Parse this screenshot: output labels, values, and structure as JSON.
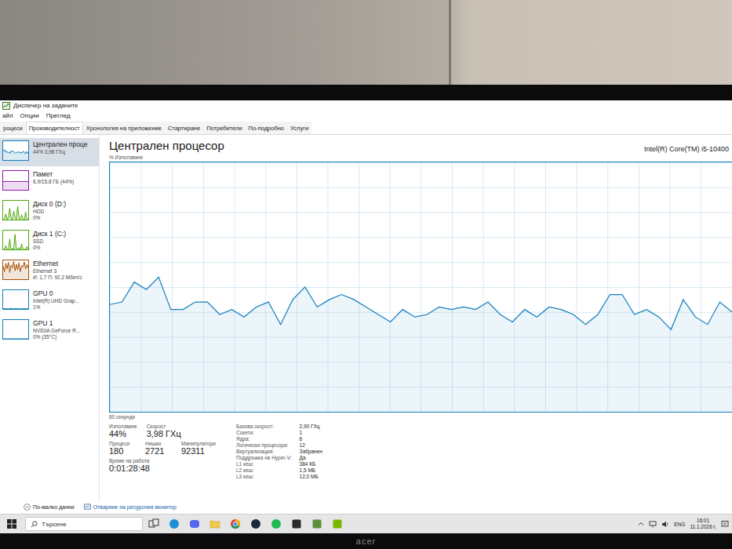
{
  "window": {
    "title": "Диспечер на задачите"
  },
  "menu": [
    "айл",
    "Опции",
    "Преглед"
  ],
  "tabs": [
    {
      "label": "роцеси",
      "selected": false
    },
    {
      "label": "Производителност",
      "selected": true
    },
    {
      "label": "Хронология на приложение",
      "selected": false
    },
    {
      "label": "Стартиране",
      "selected": false
    },
    {
      "label": "Потребители",
      "selected": false
    },
    {
      "label": "По-подробно",
      "selected": false
    },
    {
      "label": "Услуги",
      "selected": false
    }
  ],
  "sidebar": {
    "items": [
      {
        "name": "Централен проце",
        "lines": [
          "44% 3,98 ГХц"
        ],
        "selected": true,
        "color": "#117dbb",
        "values": [
          43,
          52,
          54,
          41,
          44,
          39,
          42,
          35,
          50,
          45,
          47,
          42,
          36,
          38,
          42,
          41,
          44,
          36,
          41,
          39,
          47,
          39,
          33,
          45,
          35,
          44
        ]
      },
      {
        "name": "Памет",
        "lines": [
          "6,9/15,8 ГБ (44%)"
        ],
        "selected": false,
        "color": "#8b12ae",
        "values": [
          44,
          44,
          44,
          44,
          44,
          44,
          44,
          44,
          44,
          44,
          44,
          44,
          44,
          44,
          44,
          44
        ]
      },
      {
        "name": "Диск 0 (D:)",
        "lines": [
          "HDD",
          "0%"
        ],
        "selected": false,
        "color": "#4da60c",
        "values": [
          0,
          5,
          30,
          0,
          10,
          60,
          5,
          0,
          45,
          15,
          0,
          70,
          10,
          0,
          25,
          5,
          0,
          40,
          0,
          0
        ]
      },
      {
        "name": "Диск 1 (C:)",
        "lines": [
          "SSD",
          "0%"
        ],
        "selected": false,
        "color": "#4da60c",
        "values": [
          0,
          0,
          20,
          0,
          0,
          55,
          0,
          5,
          0,
          80,
          0,
          0,
          10,
          0,
          30,
          0,
          0,
          0,
          15,
          0
        ]
      },
      {
        "name": "Ethernet",
        "lines": [
          "Ethernet 3",
          "И: 1,7 П: 92,2 Мбит/с"
        ],
        "selected": false,
        "color": "#a74f01",
        "values": [
          70,
          40,
          85,
          55,
          90,
          35,
          75,
          60,
          95,
          45,
          80,
          50,
          88,
          40,
          72,
          65,
          92,
          55,
          78,
          60
        ]
      },
      {
        "name": "GPU 0",
        "lines": [
          "Intel(R) UHD Grap...",
          "1%"
        ],
        "selected": false,
        "color": "#117dbb",
        "values": [
          1,
          2,
          1,
          1,
          3,
          1,
          1,
          2,
          1,
          1,
          1,
          2,
          1,
          1
        ]
      },
      {
        "name": "GPU 1",
        "lines": [
          "NVIDIA GeForce R...",
          "0% (35°C)"
        ],
        "selected": false,
        "color": "#117dbb",
        "values": [
          0,
          0,
          0,
          0,
          0,
          0,
          0,
          0,
          0,
          0,
          0,
          0
        ]
      }
    ]
  },
  "chart": {
    "title": "Централен процесор",
    "model": "Intel(R) Core(TM) i5-10400",
    "axis_label": "% Използване",
    "time_label": "60 секунди",
    "max": 100,
    "values": [
      43,
      44,
      52,
      49,
      54,
      41,
      41,
      44,
      44,
      39,
      41,
      38,
      42,
      44,
      35,
      45,
      50,
      42,
      45,
      47,
      45,
      42,
      39,
      36,
      41,
      38,
      39,
      42,
      41,
      42,
      41,
      44,
      39,
      36,
      41,
      38,
      42,
      41,
      39,
      35,
      39,
      47,
      47,
      39,
      41,
      38,
      33,
      45,
      38,
      35,
      44,
      40
    ]
  },
  "stats": [
    [
      {
        "label": "Използване",
        "value": "44%"
      },
      {
        "label": "Скорост",
        "value": "3,98 ГХц"
      }
    ],
    [
      {
        "label": "Процеси",
        "value": "180"
      },
      {
        "label": "Нишки",
        "value": "2721"
      },
      {
        "label": "Манипулатори",
        "value": "92311"
      }
    ],
    [
      {
        "label": "Време на работа",
        "value": "0:01:28:48"
      }
    ]
  ],
  "details": [
    {
      "label": "Базова скорост:",
      "value": "2,90 ГХц"
    },
    {
      "label": "Сокети:",
      "value": "1"
    },
    {
      "label": "Ядра:",
      "value": "6"
    },
    {
      "label": "Логически процесори:",
      "value": "12"
    },
    {
      "label": "Виртуализация:",
      "value": "Забранен"
    },
    {
      "label": "Поддръжка на Hyper-V:",
      "value": "Да"
    },
    {
      "label": "L1 кеш:",
      "value": "384 КБ"
    },
    {
      "label": "L2 кеш:",
      "value": "1,5 МБ"
    },
    {
      "label": "L3 кеш:",
      "value": "12,0 МБ"
    }
  ],
  "footer": {
    "less": "По-малко данни",
    "monitor": "Отваряне на ресурсния монитор"
  },
  "taskbar": {
    "search": "Търсене",
    "language": "ENG",
    "time": "16:01",
    "date": "11.1.2026 г."
  },
  "bezel": {
    "logo": "acer"
  }
}
